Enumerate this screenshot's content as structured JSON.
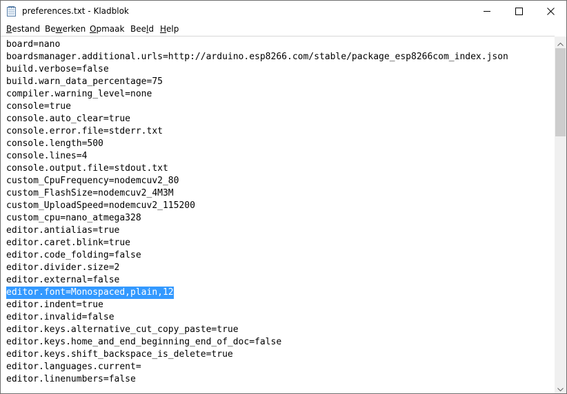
{
  "window": {
    "title": "preferences.txt - Kladblok",
    "icon": "notepad-icon",
    "controls": {
      "minimize": "minimize-icon",
      "maximize": "maximize-icon",
      "close": "close-icon"
    }
  },
  "menu": [
    {
      "before": "",
      "key": "B",
      "after": "estand"
    },
    {
      "before": "Be",
      "key": "w",
      "after": "erken"
    },
    {
      "before": "",
      "key": "O",
      "after": "pmaak"
    },
    {
      "before": "Bee",
      "key": "l",
      "after": "d"
    },
    {
      "before": "",
      "key": "H",
      "after": "elp"
    }
  ],
  "editor": {
    "selected_line": 20,
    "lines": [
      "board=nano",
      "boardsmanager.additional.urls=http://arduino.esp8266.com/stable/package_esp8266com_index.json",
      "build.verbose=false",
      "build.warn_data_percentage=75",
      "compiler.warning_level=none",
      "console=true",
      "console.auto_clear=true",
      "console.error.file=stderr.txt",
      "console.length=500",
      "console.lines=4",
      "console.output.file=stdout.txt",
      "custom_CpuFrequency=nodemcuv2_80",
      "custom_FlashSize=nodemcuv2_4M3M",
      "custom_UploadSpeed=nodemcuv2_115200",
      "custom_cpu=nano_atmega328",
      "editor.antialias=true",
      "editor.caret.blink=true",
      "editor.code_folding=false",
      "editor.divider.size=2",
      "editor.external=false",
      "editor.font=Monospaced,plain,12",
      "editor.indent=true",
      "editor.invalid=false",
      "editor.keys.alternative_cut_copy_paste=true",
      "editor.keys.home_and_end_beginning_end_of_doc=false",
      "editor.keys.shift_backspace_is_delete=true",
      "editor.languages.current=",
      "editor.linenumbers=false"
    ]
  },
  "scrollbar": {
    "position": 0,
    "up_icon": "scroll-up-arrow-icon",
    "down_icon": "scroll-down-arrow-icon"
  }
}
